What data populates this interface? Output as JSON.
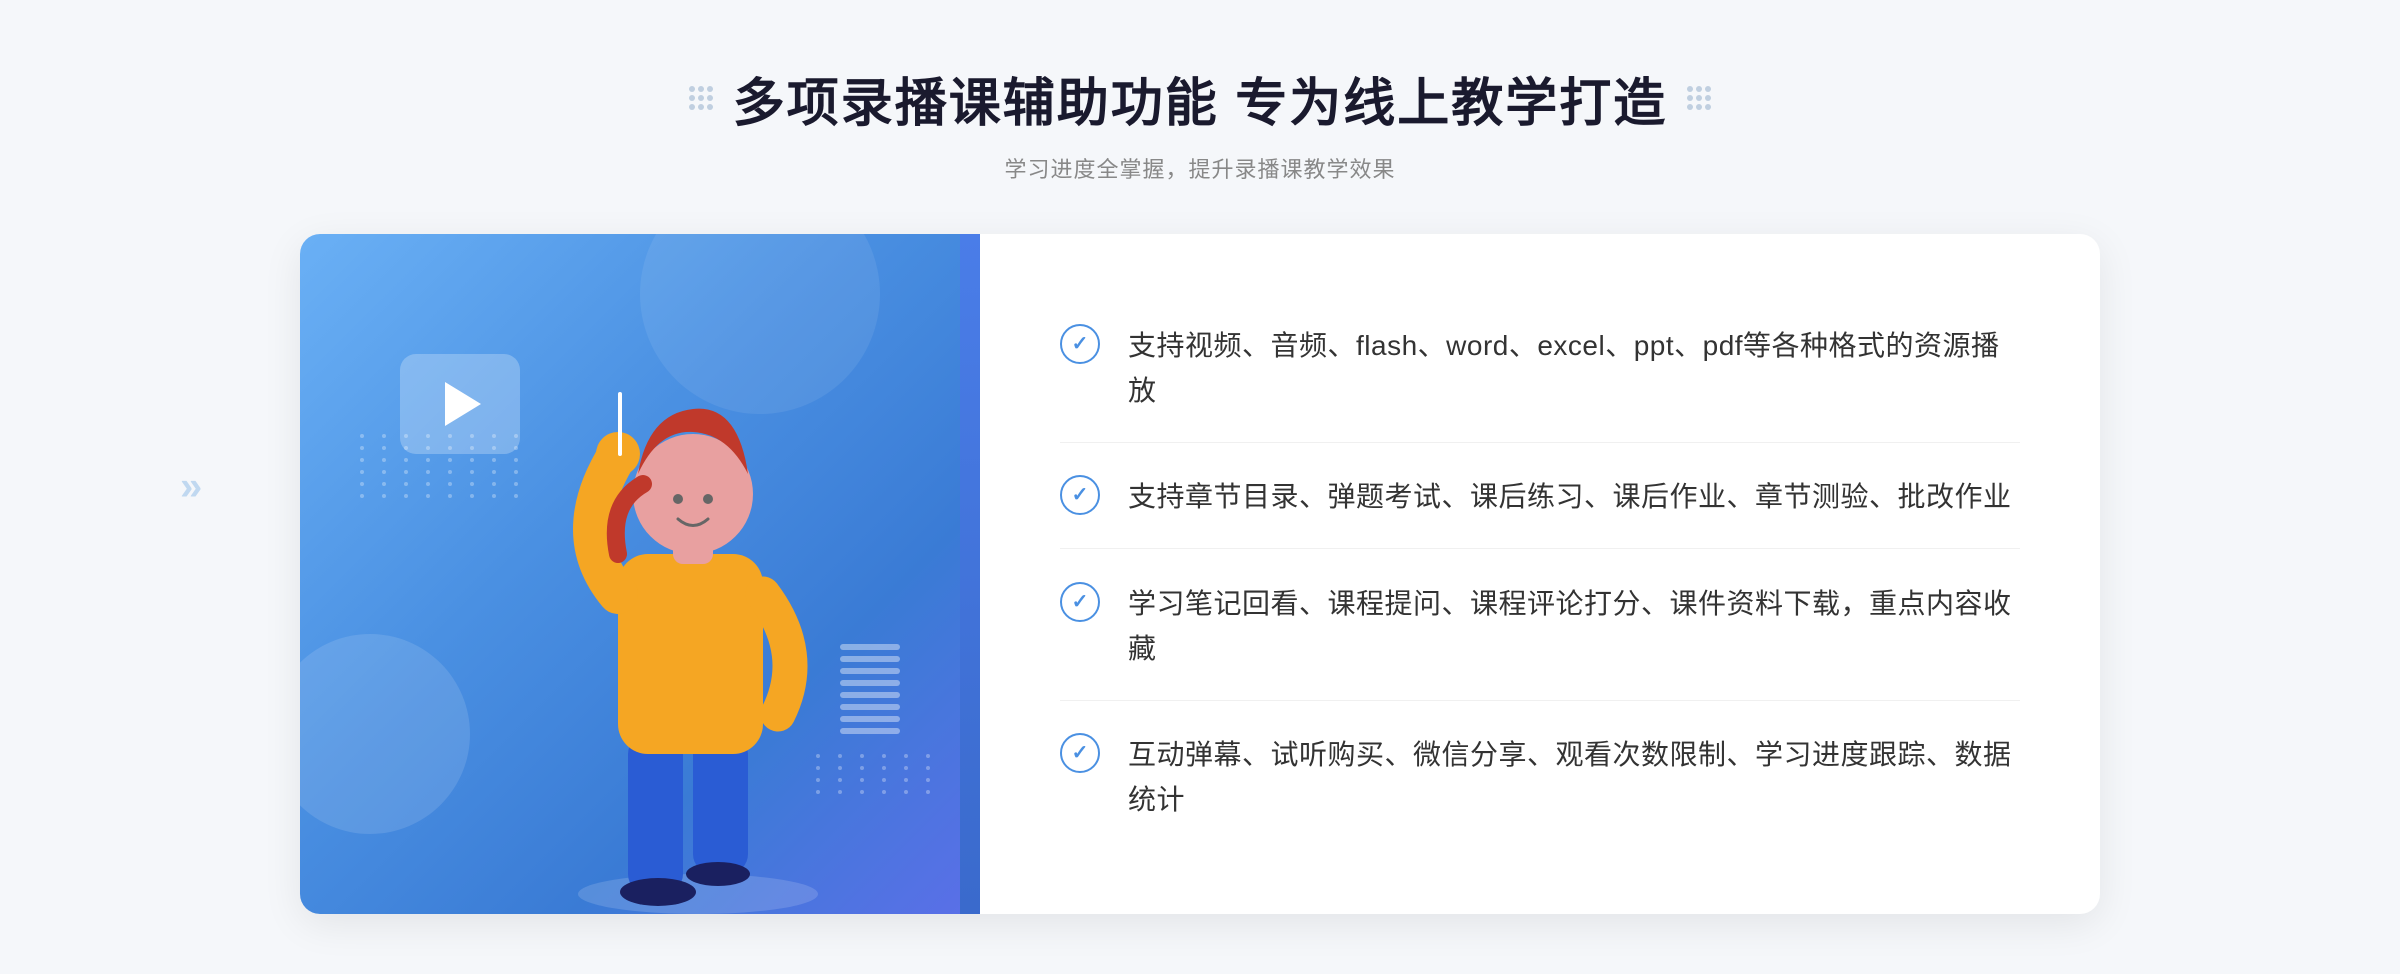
{
  "header": {
    "title": "多项录播课辅助功能 专为线上教学打造",
    "subtitle": "学习进度全掌握，提升录播课教学效果"
  },
  "features": [
    {
      "id": 1,
      "text": "支持视频、音频、flash、word、excel、ppt、pdf等各种格式的资源播放"
    },
    {
      "id": 2,
      "text": "支持章节目录、弹题考试、课后练习、课后作业、章节测验、批改作业"
    },
    {
      "id": 3,
      "text": "学习笔记回看、课程提问、课程评论打分、课件资料下载，重点内容收藏"
    },
    {
      "id": 4,
      "text": "互动弹幕、试听购买、微信分享、观看次数限制、学习进度跟踪、数据统计"
    }
  ],
  "decorative": {
    "left_arrows": "»",
    "dot_grid_label": "decorative-dot-grid"
  }
}
